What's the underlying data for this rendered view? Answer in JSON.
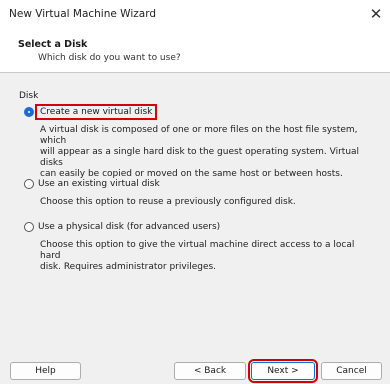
{
  "window": {
    "title": "New Virtual Machine Wizard",
    "close_glyph": "✕"
  },
  "header": {
    "title": "Select a Disk",
    "subtitle": "Which disk do you want to use?"
  },
  "disk_section": {
    "label": "Disk",
    "options": [
      {
        "label": "Create a new virtual disk",
        "checked": true,
        "description": [
          "A virtual disk is composed of one or more files on the host file system, which",
          "will appear as a single hard disk to the guest operating system. Virtual disks",
          "can easily be copied or moved on the same host or between hosts."
        ]
      },
      {
        "label": "Use an existing virtual disk",
        "checked": false,
        "description": [
          "Choose this option to reuse a previously configured disk."
        ]
      },
      {
        "label": "Use a physical disk (for advanced users)",
        "checked": false,
        "description": [
          "Choose this option to give the virtual machine direct access to a local hard",
          "disk. Requires administrator privileges."
        ]
      }
    ]
  },
  "buttons": {
    "help": "Help",
    "back": "< Back",
    "next": "Next >",
    "cancel": "Cancel"
  },
  "colors": {
    "highlight": "#d40000",
    "radio_selected": "#1a6bd6"
  }
}
